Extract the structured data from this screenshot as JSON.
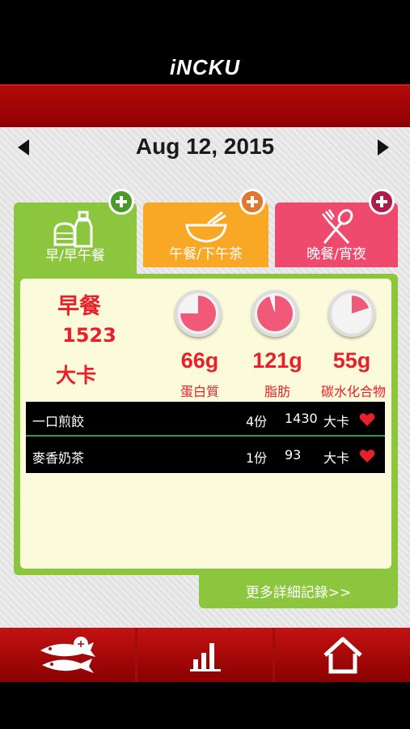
{
  "app": {
    "logo": "iNCKU"
  },
  "date": {
    "text": "Aug 12, 2015"
  },
  "tabs": [
    {
      "label": "早/早午餐",
      "color": "#8cc63f",
      "icon": "breakfast-icon"
    },
    {
      "label": "午餐/下午茶",
      "color": "#f9a825",
      "icon": "lunch-bowl-icon"
    },
    {
      "label": "晚餐/宵夜",
      "color": "#ee4a6e",
      "icon": "dinner-utensils-icon"
    }
  ],
  "meal": {
    "name": "早餐",
    "calories": "1523",
    "unit": "大卡"
  },
  "nutrients": [
    {
      "value": "66g",
      "label": "蛋白質",
      "pie_fraction": 0.75,
      "color": "#f05a78"
    },
    {
      "value": "121g",
      "label": "脂肪",
      "pie_fraction": 0.95,
      "color": "#f05a78"
    },
    {
      "value": "55g",
      "label": "碳水化合物",
      "pie_fraction": 0.2,
      "color": "#f05a78"
    }
  ],
  "foods": [
    {
      "name": "一口煎餃",
      "qty": "4份",
      "cal": "1430",
      "unit": "大卡"
    },
    {
      "name": "麥香奶茶",
      "qty": "1份",
      "cal": "93",
      "unit": "大卡"
    }
  ],
  "more_link": "更多詳細記錄>>",
  "bottom_nav": [
    {
      "icon": "food-fish-icon"
    },
    {
      "icon": "bar-chart-icon"
    },
    {
      "icon": "home-icon"
    }
  ]
}
